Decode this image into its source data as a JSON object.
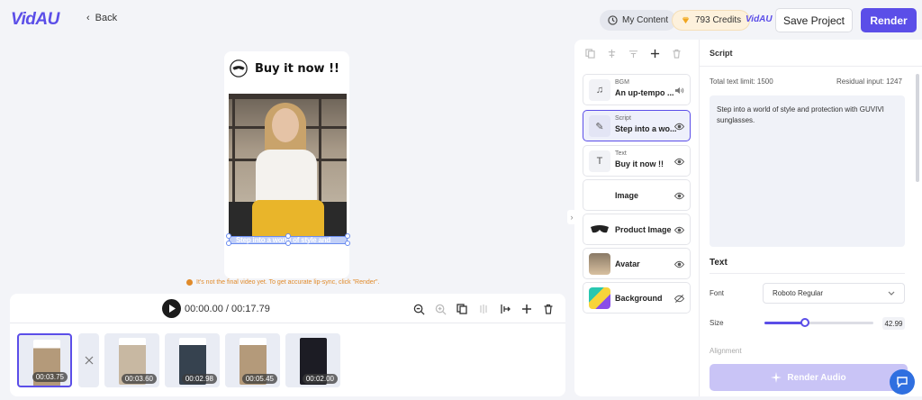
{
  "header": {
    "logo": "VidAU",
    "back_label": "Back",
    "my_content_label": "My Content",
    "credits_label": "793 Credits",
    "brand_mini": "VidAU",
    "save_label": "Save Project",
    "render_label": "Render"
  },
  "preview": {
    "ad_title": "Buy it now !!",
    "subtitle": "Step into a world of style and"
  },
  "notice": "It's not the final video yet. To get accurate lip-sync, click \"Render\".",
  "timeline": {
    "time_display": "00:00.00 / 00:17.79",
    "clips": [
      {
        "time": "00:03.75"
      },
      {
        "time": "00:03.60"
      },
      {
        "time": "00:02.98"
      },
      {
        "time": "00:05.45"
      },
      {
        "time": "00:02.00"
      }
    ]
  },
  "layers": [
    {
      "caption": "BGM",
      "name": "An up-tempo ...",
      "icon": "music-note-icon"
    },
    {
      "caption": "Script",
      "name": "Step into a wo...",
      "icon": "script-icon"
    },
    {
      "caption": "Text",
      "name": "Buy it now !!",
      "icon": "text-icon"
    },
    {
      "caption": "",
      "name": "Image",
      "icon": "image-icon"
    },
    {
      "caption": "",
      "name": "Product Image",
      "icon": "sunglasses-icon"
    },
    {
      "caption": "",
      "name": "Avatar",
      "icon": "avatar-icon"
    },
    {
      "caption": "",
      "name": "Background",
      "icon": "background-icon"
    }
  ],
  "script_panel": {
    "title": "Script",
    "total_limit": "Total text limit: 1500",
    "residual": "Residual input: 1247",
    "script_text": "Step into a world of style and protection with GUVIVI sunglasses.",
    "text_heading": "Text",
    "font_label": "Font",
    "font_value": "Roboto Regular",
    "size_label": "Size",
    "size_value": "42.99",
    "size_slider_fraction": 0.37,
    "alignment_label": "Alignment",
    "render_audio_label": "Render Audio"
  },
  "colors": {
    "accent": "#5b4ee8",
    "credits_bg": "#fdf1dc",
    "notice": "#e08a2a",
    "fab": "#2f6fe0"
  }
}
